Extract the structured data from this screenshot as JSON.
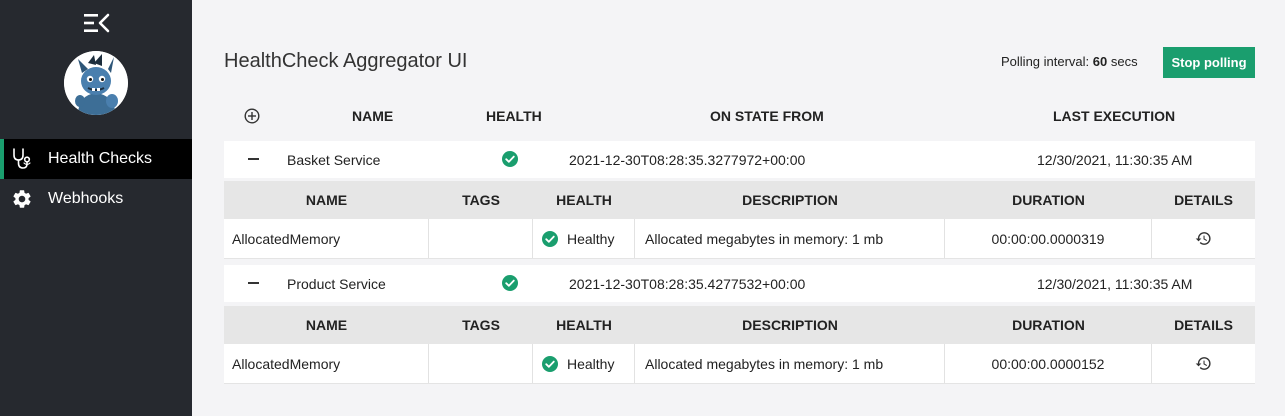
{
  "app": {
    "title": "HealthCheck Aggregator UI"
  },
  "sidebar": {
    "items": [
      {
        "label": "Health Checks",
        "icon": "stethoscope-icon",
        "active": true
      },
      {
        "label": "Webhooks",
        "icon": "gear-icon",
        "active": false
      }
    ]
  },
  "polling": {
    "label": "Polling interval:",
    "value": "60",
    "unit": "secs",
    "button": "Stop polling"
  },
  "main_columns": [
    "NAME",
    "HEALTH",
    "ON STATE FROM",
    "LAST EXECUTION"
  ],
  "detail_columns": [
    "NAME",
    "TAGS",
    "HEALTH",
    "DESCRIPTION",
    "DURATION",
    "DETAILS"
  ],
  "services": [
    {
      "name": "Basket Service",
      "status": "healthy",
      "on_state_from": "2021-12-30T08:28:35.3277972+00:00",
      "last_execution": "12/30/2021, 11:30:35 AM",
      "entries": [
        {
          "name": "AllocatedMemory",
          "tags": "",
          "health": "Healthy",
          "description": "Allocated megabytes in memory: 1 mb",
          "duration": "00:00:00.0000319"
        }
      ]
    },
    {
      "name": "Product Service",
      "status": "healthy",
      "on_state_from": "2021-12-30T08:28:35.4277532+00:00",
      "last_execution": "12/30/2021, 11:30:35 AM",
      "entries": [
        {
          "name": "AllocatedMemory",
          "tags": "",
          "health": "Healthy",
          "description": "Allocated megabytes in memory: 1 mb",
          "duration": "00:00:00.0000152"
        }
      ]
    }
  ],
  "colors": {
    "sidebar": "#26292f",
    "accent": "#1a9e6e",
    "healthy": "#1a9e6e"
  }
}
